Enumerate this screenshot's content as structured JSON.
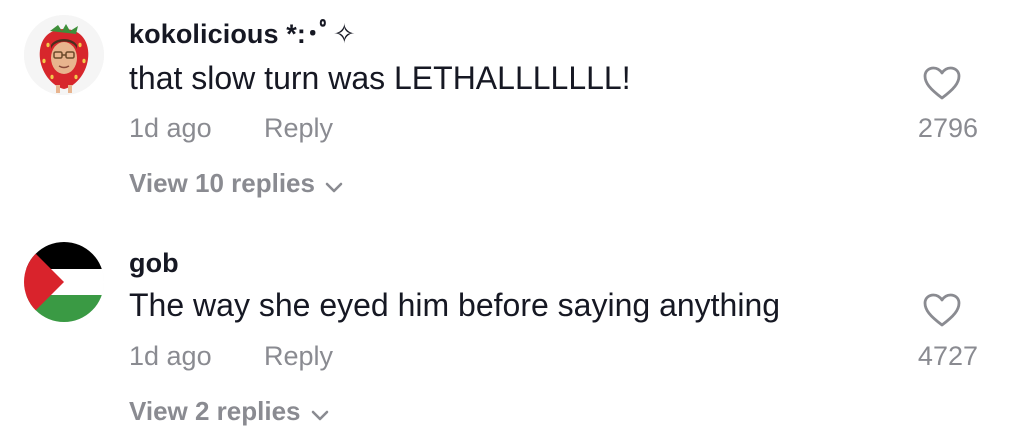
{
  "comments": [
    {
      "username": "kokolicious *:･ﾟ✧",
      "text": "that slow turn was LETHALLLLLLL!",
      "time": "1d ago",
      "reply_label": "Reply",
      "likes": "2796",
      "view_replies": "View 10 replies",
      "avatar_icon": "strawberry-avatar"
    },
    {
      "username": "gob",
      "text": "The way she eyed him before saying anything",
      "time": "1d ago",
      "reply_label": "Reply",
      "likes": "4727",
      "view_replies": "View 2 replies",
      "avatar_icon": "palestine-flag-avatar"
    }
  ],
  "colors": {
    "text": "#161823",
    "secondary": "#8a8b91",
    "flag_red": "#d9232c",
    "flag_green": "#3a9a44",
    "flag_black": "#000000"
  }
}
